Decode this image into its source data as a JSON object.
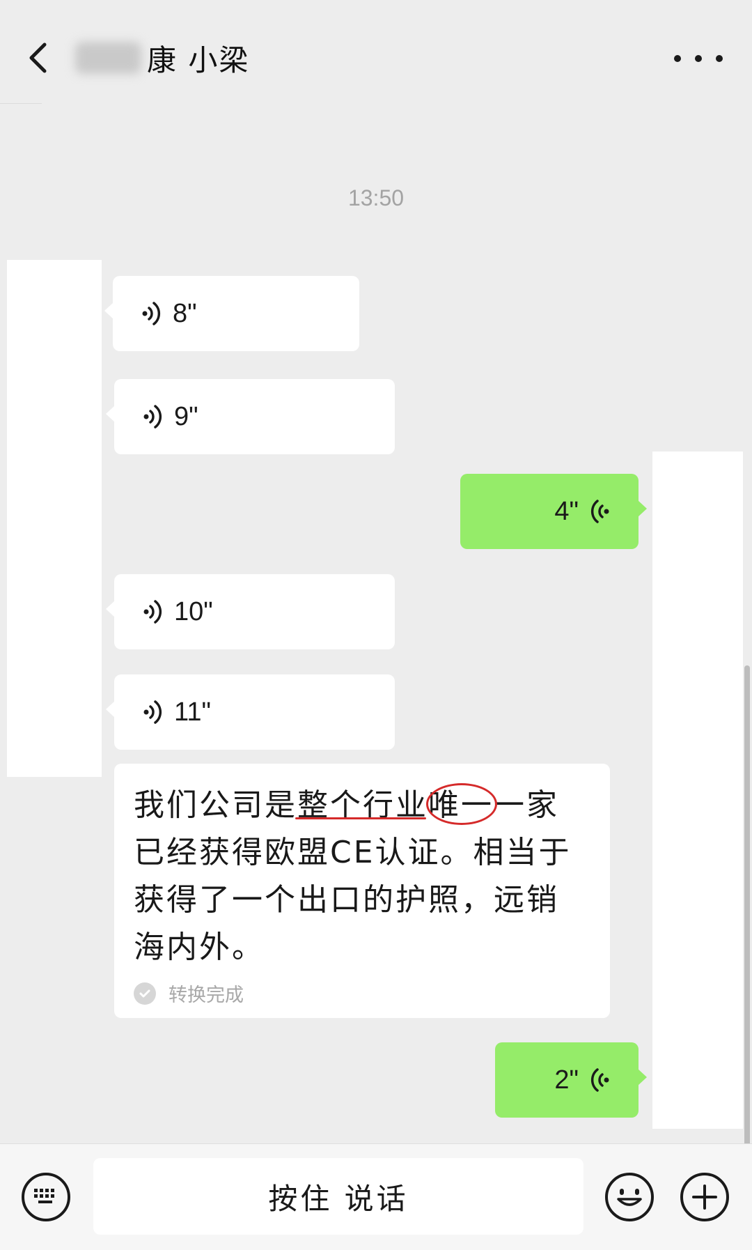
{
  "header": {
    "title": "康 小梁"
  },
  "chat": {
    "timestamp": "13:50",
    "voice_messages": [
      {
        "side": "left",
        "duration": "8\""
      },
      {
        "side": "left",
        "duration": "9\""
      },
      {
        "side": "right",
        "duration": "4\""
      },
      {
        "side": "left",
        "duration": "10\""
      },
      {
        "side": "left",
        "duration": "11\""
      },
      {
        "side": "right",
        "duration": "2\""
      }
    ],
    "transcript": {
      "text": "我们公司是整个行业唯一一家已经获得欧盟CE认证。相当于获得了一个出口的护照，远销海内外。",
      "status": "转换完成"
    }
  },
  "input_bar": {
    "hold_to_talk": "按住 说话"
  },
  "colors": {
    "background": "#ededed",
    "sent_bubble": "#95ec69",
    "received_bubble": "#ffffff",
    "annotation": "#d52a2a"
  }
}
